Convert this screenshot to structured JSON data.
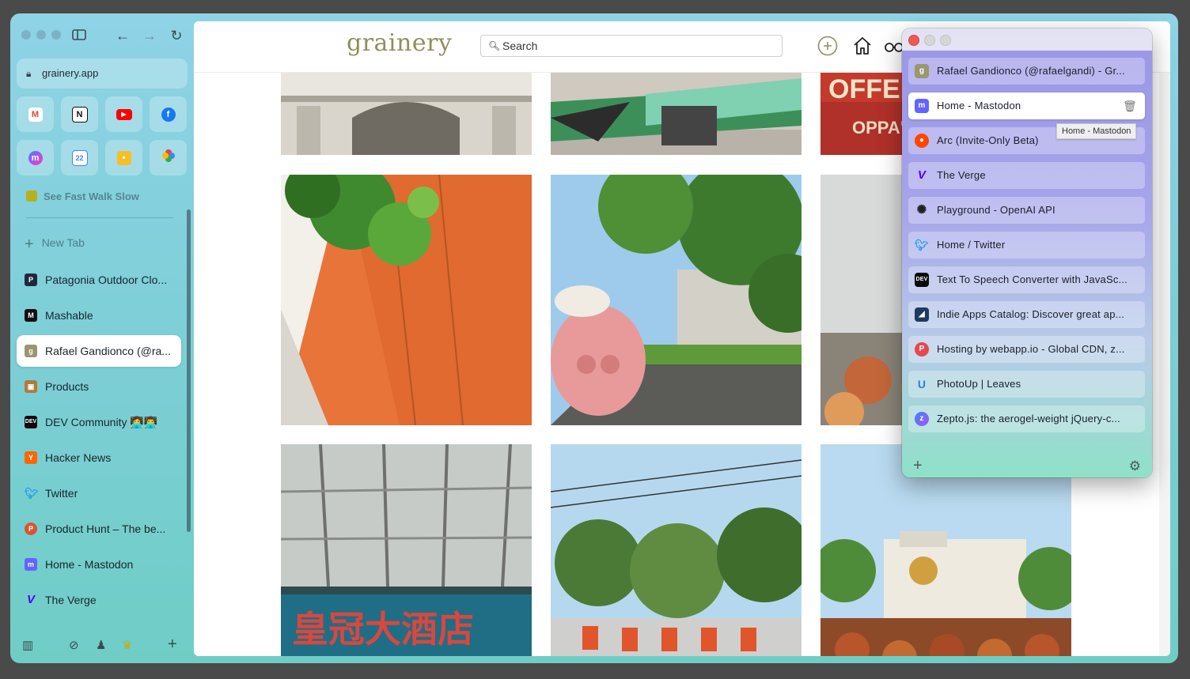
{
  "browser": {
    "url": "grainery.app",
    "space_name": "See Fast Walk Slow",
    "new_tab_label": "New Tab",
    "favorites": [
      {
        "name": "Gmail",
        "icon": "gmail-icon",
        "glyph": "M",
        "color": "#ea4335"
      },
      {
        "name": "Notion",
        "icon": "notion-icon",
        "glyph": "N",
        "color": "#111111"
      },
      {
        "name": "YouTube",
        "icon": "youtube-icon",
        "glyph": "▶",
        "color": "#ff0000"
      },
      {
        "name": "Facebook",
        "icon": "facebook-icon",
        "glyph": "f",
        "color": "#1877f2"
      },
      {
        "name": "Messenger",
        "icon": "messenger-icon",
        "glyph": "m",
        "color": "#8b5cf6"
      },
      {
        "name": "Google Calendar",
        "icon": "calendar-icon",
        "glyph": "22",
        "color": "#4285f4"
      },
      {
        "name": "Google Keep",
        "icon": "keep-icon",
        "glyph": "•",
        "color": "#f6bf26"
      },
      {
        "name": "Google Photos",
        "icon": "photos-icon",
        "glyph": "✦",
        "color": "#34a853"
      }
    ],
    "tabs": [
      {
        "title": "Patagonia Outdoor Clo...",
        "icon": "patagonia-icon",
        "glyph": "P",
        "color": "#1e2a3a"
      },
      {
        "title": "Mashable",
        "icon": "mashable-icon",
        "glyph": "M",
        "color": "#111111"
      },
      {
        "title": "Rafael Gandionco (@ra...",
        "icon": "grainery-icon",
        "glyph": "g",
        "color": "#9a9670",
        "active": true
      },
      {
        "title": "Products",
        "icon": "box-icon",
        "glyph": "▣",
        "color": "#b07a3a"
      },
      {
        "title": "DEV Community 👩‍💻👨‍💻",
        "icon": "dev-icon",
        "glyph": "DEV",
        "color": "#0a0a0a"
      },
      {
        "title": "Hacker News",
        "icon": "hackernews-icon",
        "glyph": "Y",
        "color": "#ff6600"
      },
      {
        "title": "Twitter",
        "icon": "twitter-icon",
        "glyph": "t",
        "color": "#1d9bf0"
      },
      {
        "title": "Product Hunt – The be...",
        "icon": "producthunt-icon",
        "glyph": "P",
        "color": "#da552f"
      },
      {
        "title": "Home - Mastodon",
        "icon": "mastodon-icon",
        "glyph": "m",
        "color": "#6364ff"
      },
      {
        "title": "The Verge",
        "icon": "verge-icon",
        "glyph": "V",
        "color": "#5200ff"
      }
    ]
  },
  "site": {
    "logo": "grainery",
    "search_placeholder": "Search",
    "photos": [
      {
        "alt": "Church facade",
        "c1": "#e9e6df",
        "c2": "#8e8a80"
      },
      {
        "alt": "Street float",
        "c1": "#cfc9c0",
        "c2": "#3d8f5a"
      },
      {
        "alt": "Coffee shop sign",
        "c1": "#c43a2c",
        "c2": "#f1e5c7"
      },
      {
        "alt": "Orange wall with tree shadows",
        "c1": "#e8743a",
        "c2": "#3f8a2e"
      },
      {
        "alt": "Pig float on street",
        "c1": "#9ecbec",
        "c2": "#3e7a2e"
      },
      {
        "alt": "Festival dancers",
        "c1": "#b7c5ca",
        "c2": "#c3663a"
      },
      {
        "alt": "Hotel glass canopy",
        "c1": "#c6cbc8",
        "c2": "#b0332c"
      },
      {
        "alt": "Street parade under trees",
        "c1": "#b6d8ee",
        "c2": "#e0552c"
      },
      {
        "alt": "City hall festival crowd",
        "c1": "#b9daf0",
        "c2": "#b8552a"
      }
    ]
  },
  "popup": {
    "tooltip": "Home - Mastodon",
    "tabs": [
      {
        "title": "Rafael Gandionco (@rafaelgandi) - Gr...",
        "icon": "grainery-icon",
        "glyph": "g",
        "color": "#9a9670"
      },
      {
        "title": "Home - Mastodon",
        "icon": "mastodon-icon",
        "glyph": "m",
        "color": "#6364ff",
        "active": true
      },
      {
        "title": "Arc (Invite-Only Beta)",
        "icon": "reddit-icon",
        "glyph": "●",
        "color": "#ff4500"
      },
      {
        "title": "The Verge",
        "icon": "verge-icon",
        "glyph": "V",
        "color": "#5200ff"
      },
      {
        "title": "Playground - OpenAI API",
        "icon": "openai-icon",
        "glyph": "✺",
        "color": "#202123"
      },
      {
        "title": "Home / Twitter",
        "icon": "twitter-icon",
        "glyph": "t",
        "color": "#1d9bf0"
      },
      {
        "title": "Text To Speech Converter with JavaSc...",
        "icon": "dev-icon",
        "glyph": "DEV",
        "color": "#0a0a0a"
      },
      {
        "title": "Indie Apps Catalog: Discover great ap...",
        "icon": "indieapps-icon",
        "glyph": "◢",
        "color": "#1e3a5f"
      },
      {
        "title": "Hosting by webapp.io - Global CDN, z...",
        "icon": "webapp-icon",
        "glyph": "P",
        "color": "#e5484d"
      },
      {
        "title": "PhotoUp | Leaves",
        "icon": "photoup-icon",
        "glyph": "U",
        "color": "#2f7de1"
      },
      {
        "title": "Zepto.js: the aerogel-weight jQuery-c...",
        "icon": "zepto-icon",
        "glyph": "z",
        "color": "#7b61ff"
      }
    ]
  }
}
